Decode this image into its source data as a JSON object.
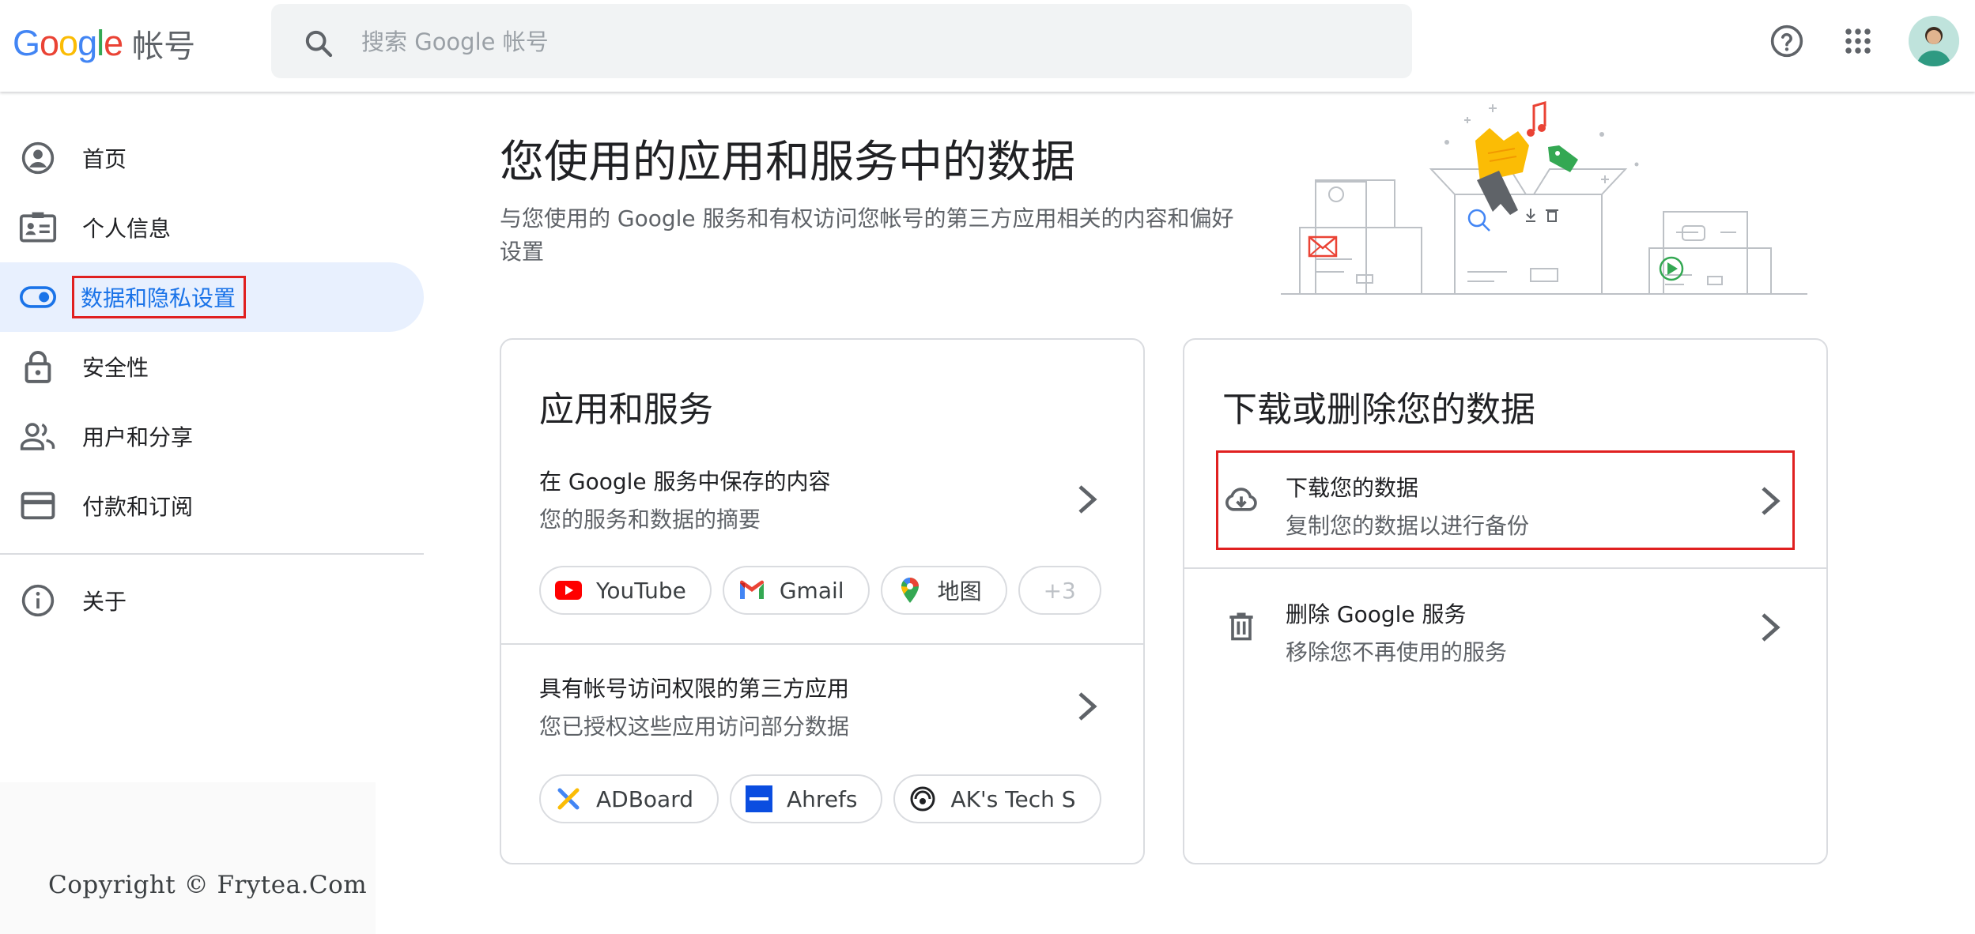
{
  "header": {
    "logo_word": "Google",
    "logo_account": "帐号",
    "search_placeholder": "搜索 Google 帐号",
    "icons": [
      "search-icon",
      "help-icon",
      "apps-grid-icon",
      "avatar"
    ]
  },
  "sidebar": {
    "items": [
      {
        "label": "首页",
        "icon": "home-person-icon"
      },
      {
        "label": "个人信息",
        "icon": "id-card-icon"
      },
      {
        "label": "数据和隐私设置",
        "icon": "toggle-icon",
        "active": true
      },
      {
        "label": "安全性",
        "icon": "lock-icon"
      },
      {
        "label": "用户和分享",
        "icon": "people-icon"
      },
      {
        "label": "付款和订阅",
        "icon": "credit-card-icon"
      },
      {
        "label": "关于",
        "icon": "info-icon"
      }
    ]
  },
  "watermark": "Copyright © Frytea.Com",
  "main": {
    "title": "您使用的应用和服务中的数据",
    "description": "与您使用的 Google 服务和有权访问您帐号的第三方应用相关的内容和偏好设置"
  },
  "apps_card": {
    "title": "应用和服务",
    "saved": {
      "title": "在 Google 服务中保存的内容",
      "subtitle": "您的服务和数据的摘要",
      "chips": [
        "YouTube",
        "Gmail",
        "地图",
        "+3"
      ]
    },
    "third_party": {
      "title": "具有帐号访问权限的第三方应用",
      "subtitle": "您已授权这些应用访问部分数据",
      "chips": [
        "ADBoard",
        "Ahrefs",
        "AK's Tech S"
      ]
    }
  },
  "download_card": {
    "title": "下载或删除您的数据",
    "download": {
      "title": "下载您的数据",
      "subtitle": "复制您的数据以进行备份"
    },
    "delete": {
      "title": "删除 Google 服务",
      "subtitle": "移除您不再使用的服务"
    }
  },
  "colors": {
    "accent_blue": "#1a73e8",
    "active_bg": "#e8f0fe",
    "highlight_red": "#e02020",
    "google_blue": "#4285f4",
    "google_red": "#ea4335",
    "google_yellow": "#fbbc05",
    "google_green": "#34a853"
  }
}
